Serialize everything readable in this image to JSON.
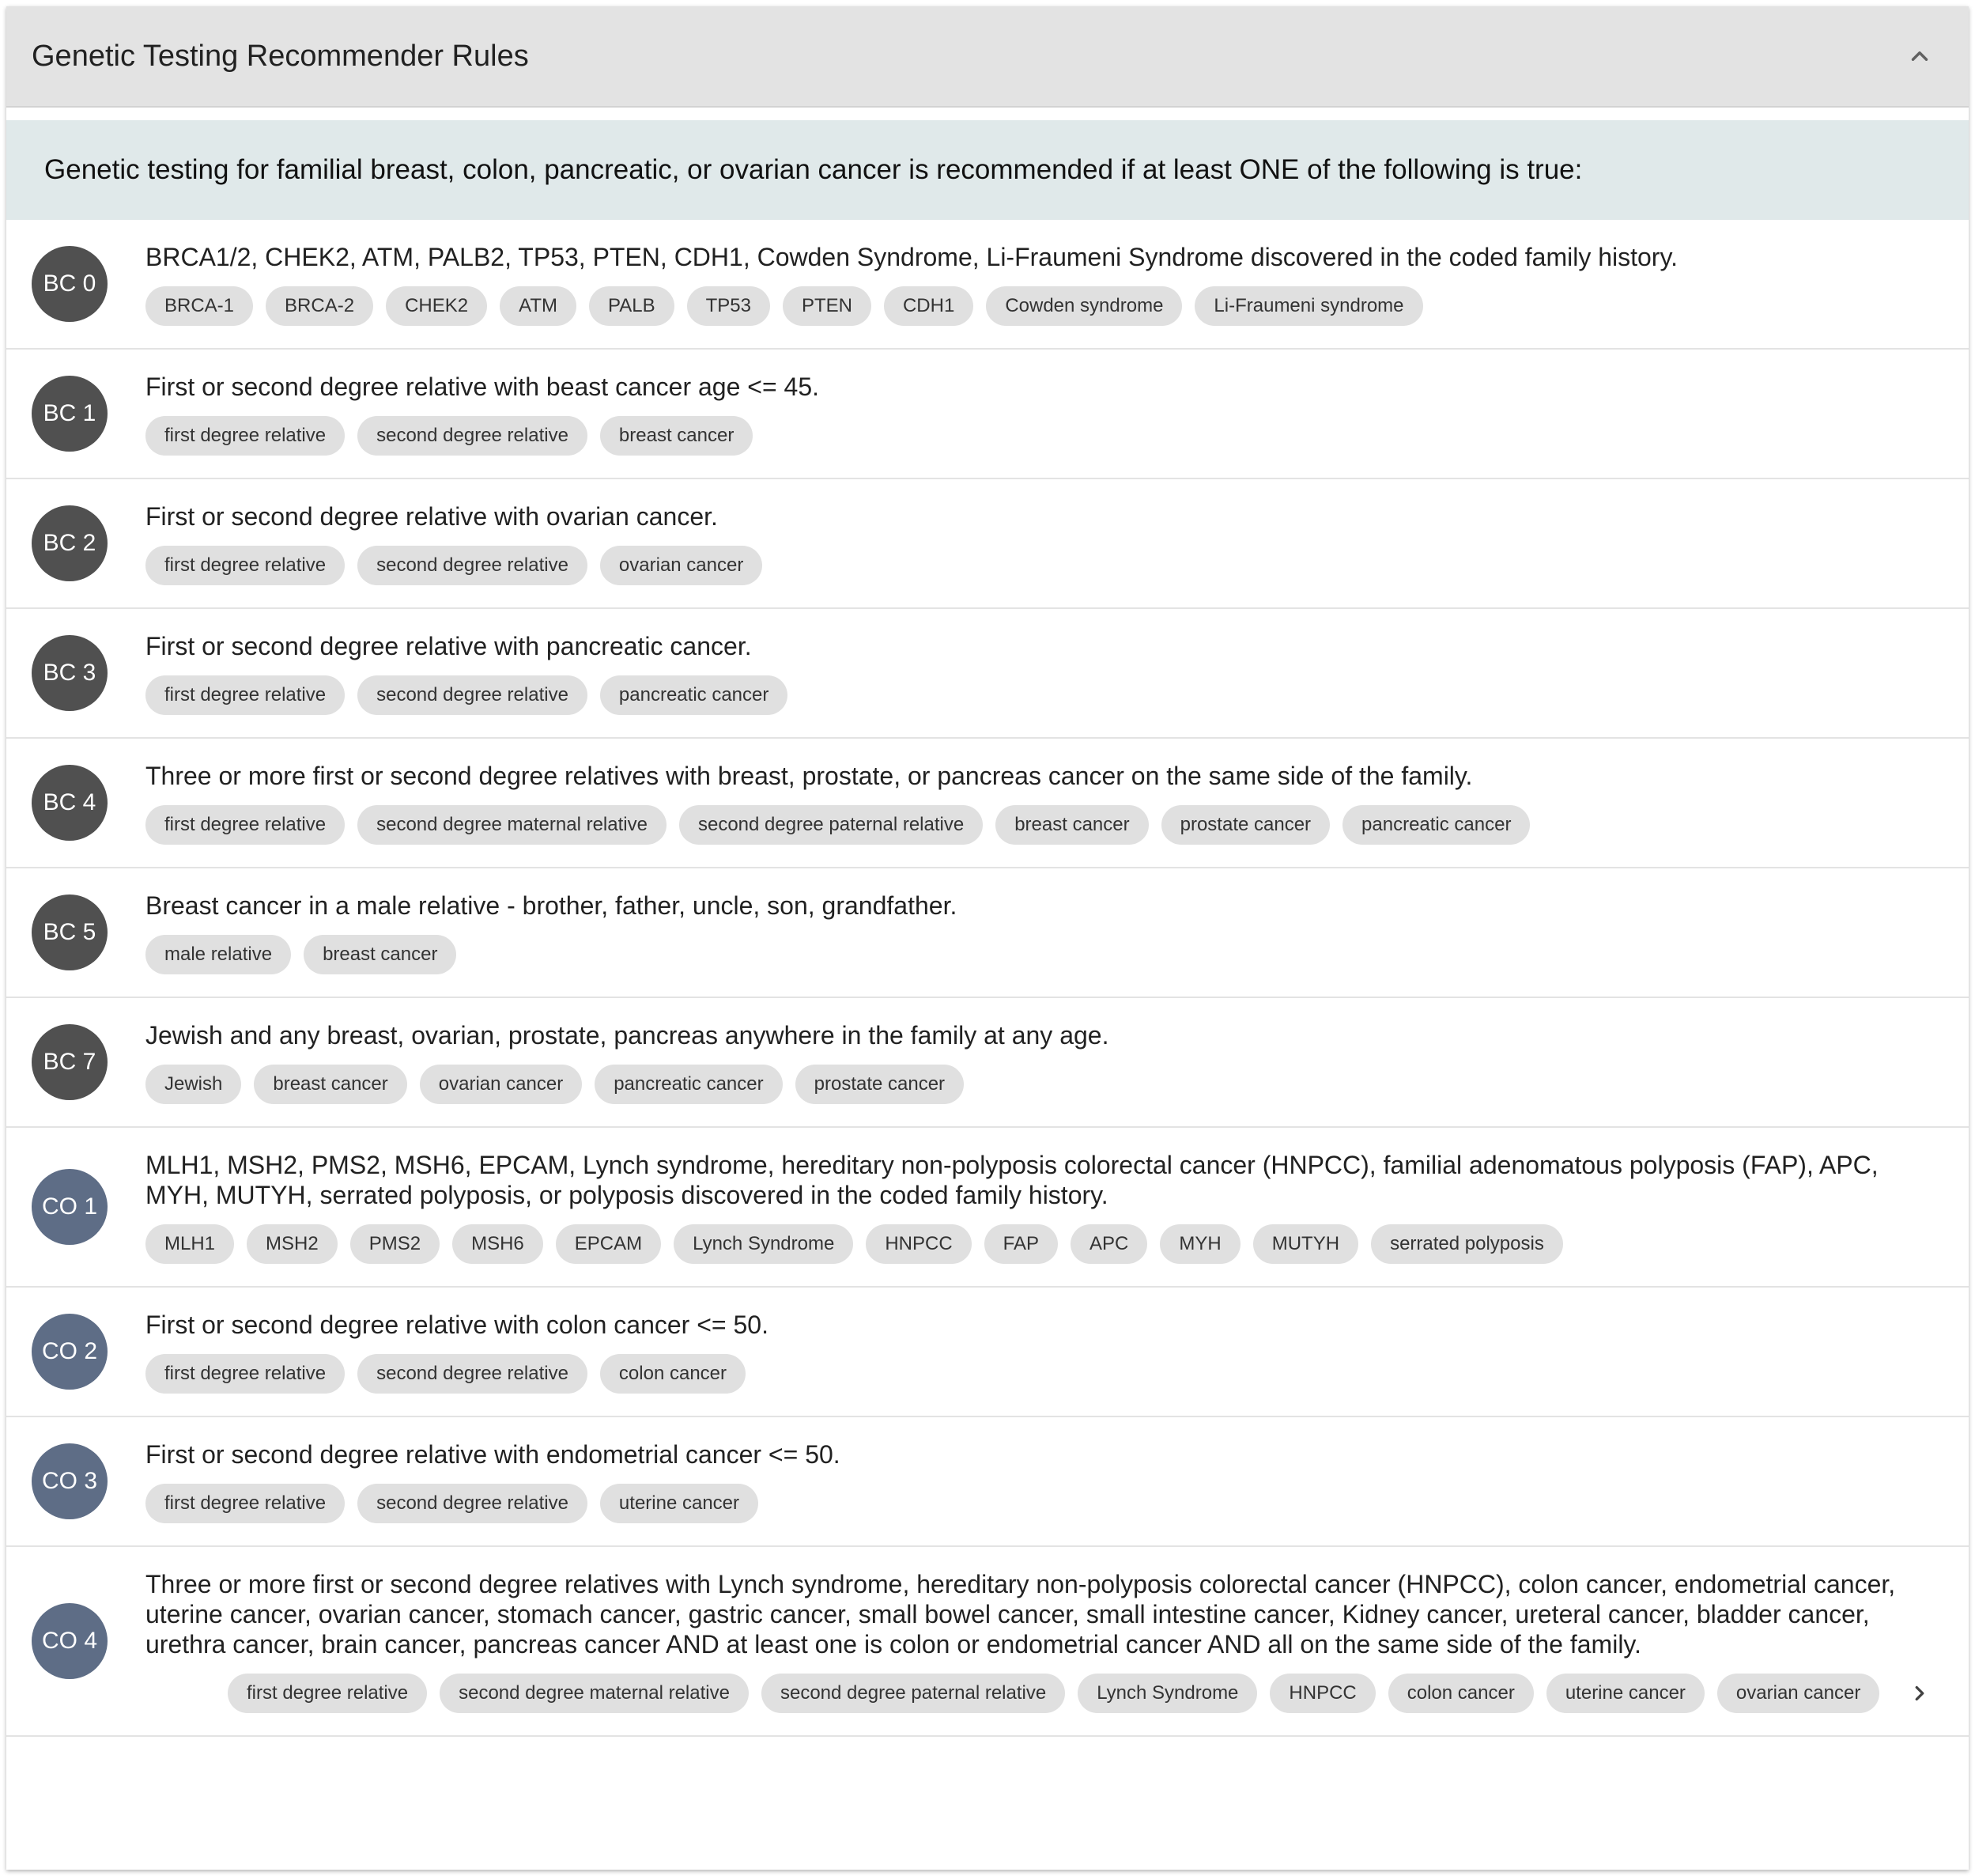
{
  "panel": {
    "title": "Genetic Testing Recommender Rules",
    "toggle_icon": "chevron-up-icon"
  },
  "banner": "Genetic testing for familial breast, colon, pancreatic, or ovarian cancer is recommended if at least ONE of the following is true:",
  "colors": {
    "bc_avatar": "#505050",
    "co_avatar": "#5e6d86",
    "banner_bg": "#e0e9ea"
  },
  "rules": [
    {
      "code": "BC 0",
      "description": "BRCA1/2, CHEK2, ATM, PALB2, TP53, PTEN, CDH1, Cowden Syndrome, Li-Fraumeni Syndrome discovered in the coded family history.",
      "tags": [
        "BRCA-1",
        "BRCA-2",
        "CHEK2",
        "ATM",
        "PALB",
        "TP53",
        "PTEN",
        "CDH1",
        "Cowden syndrome",
        "Li-Fraumeni syndrome"
      ]
    },
    {
      "code": "BC 1",
      "description": "First or second degree relative with beast cancer age <= 45.",
      "tags": [
        "first degree relative",
        "second degree relative",
        "breast cancer"
      ]
    },
    {
      "code": "BC 2",
      "description": "First or second degree relative with ovarian cancer.",
      "tags": [
        "first degree relative",
        "second degree relative",
        "ovarian cancer"
      ]
    },
    {
      "code": "BC 3",
      "description": "First or second degree relative with pancreatic cancer.",
      "tags": [
        "first degree relative",
        "second degree relative",
        "pancreatic cancer"
      ]
    },
    {
      "code": "BC 4",
      "description": "Three or more first or second degree relatives with breast, prostate, or pancreas cancer on the same side of the family.",
      "tags": [
        "first degree relative",
        "second degree maternal relative",
        "second degree paternal relative",
        "breast cancer",
        "prostate cancer",
        "pancreatic cancer"
      ]
    },
    {
      "code": "BC 5",
      "description": "Breast cancer in a male relative - brother, father, uncle, son, grandfather.",
      "tags": [
        "male relative",
        "breast cancer"
      ]
    },
    {
      "code": "BC 7",
      "description": "Jewish and any breast, ovarian, prostate, pancreas anywhere in the family at any age.",
      "tags": [
        "Jewish",
        "breast cancer",
        "ovarian cancer",
        "pancreatic cancer",
        "prostate cancer"
      ]
    },
    {
      "code": "CO 1",
      "description": "MLH1, MSH2, PMS2, MSH6, EPCAM, Lynch syndrome, hereditary non-polyposis colorectal cancer (HNPCC), familial adenomatous polyposis (FAP), APC, MYH, MUTYH, serrated polyposis, or polyposis discovered in the coded family history.",
      "tags": [
        "MLH1",
        "MSH2",
        "PMS2",
        "MSH6",
        "EPCAM",
        "Lynch Syndrome",
        "HNPCC",
        "FAP",
        "APC",
        "MYH",
        "MUTYH",
        "serrated polyposis"
      ]
    },
    {
      "code": "CO 2",
      "description": "First or second degree relative with colon cancer <= 50.",
      "tags": [
        "first degree relative",
        "second degree relative",
        "colon cancer"
      ]
    },
    {
      "code": "CO 3",
      "description": "First or second degree relative with endometrial cancer <= 50.",
      "tags": [
        "first degree relative",
        "second degree relative",
        "uterine cancer"
      ]
    },
    {
      "code": "CO 4",
      "description": "Three or more first or second degree relatives with Lynch syndrome, hereditary non-polyposis colorectal cancer (HNPCC), colon cancer, endometrial cancer, uterine cancer, ovarian cancer, stomach cancer, gastric cancer, small bowel cancer, small intestine cancer, Kidney cancer, ureteral cancer, bladder cancer, urethra cancer, brain cancer, pancreas cancer AND at least one is colon or endometrial cancer AND all on the same side of the family.",
      "tags": [
        "first degree relative",
        "second degree maternal relative",
        "second degree paternal relative",
        "Lynch Syndrome",
        "HNPCC",
        "colon cancer",
        "uterine cancer",
        "ovarian cancer"
      ],
      "scroll_icon": "chevron-right-icon"
    }
  ]
}
